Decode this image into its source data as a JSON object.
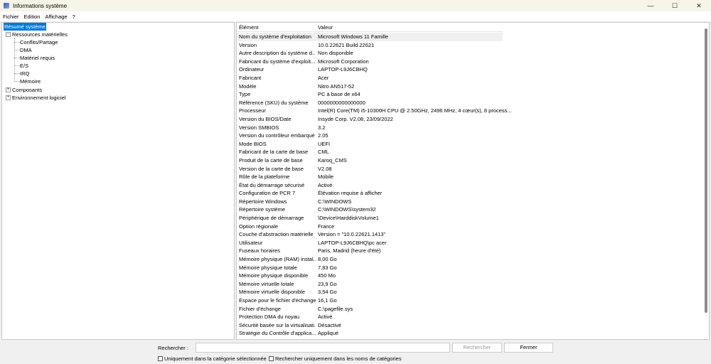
{
  "window": {
    "title": "Informations système",
    "minimize": "—",
    "maximize": "☐",
    "close": "✕"
  },
  "menu": [
    "Fichier",
    "Edition",
    "Affichage",
    "?"
  ],
  "tree": {
    "root": "Résumé système",
    "hardware": "Ressources matérielles",
    "hardware_children": [
      "Conflits/Partage",
      "DMA",
      "Matériel requis",
      "E/S",
      "IRQ",
      "Mémoire"
    ],
    "components": "Composants",
    "software": "Environnement logiciel"
  },
  "table": {
    "headers": [
      "Élément",
      "Valeur"
    ],
    "rows": [
      [
        "Nom du système d'exploitation",
        "Microsoft Windows 11 Famille"
      ],
      [
        "Version",
        "10.0.22621 Build 22621"
      ],
      [
        "Autre description du système d...",
        "Non disponible"
      ],
      [
        "Fabricant du système d'exploit...",
        "Microsoft Corporation"
      ],
      [
        "Ordinateur",
        "LAPTOP-L9J6CBHQ"
      ],
      [
        "Fabricant",
        "Acer"
      ],
      [
        "Modèle",
        "Nitro AN517-52"
      ],
      [
        "Type",
        "PC à base de x64"
      ],
      [
        "Référence (SKU) du système",
        "0000000000000000"
      ],
      [
        "Processeur",
        "Intel(R) Core(TM) i5-10300H CPU @ 2.50GHz, 2496 MHz, 4 cœur(s), 8 process..."
      ],
      [
        "Version du BIOS/Date",
        "Insyde Corp. V2.08, 23/09/2022"
      ],
      [
        "Version SMBIOS",
        "3.2"
      ],
      [
        "Version du contrôleur embarqué",
        "2.05"
      ],
      [
        "Mode BIOS",
        "UEFI"
      ],
      [
        "Fabricant de la carte de base",
        "CML"
      ],
      [
        "Produit de la carte de base",
        "Karoq_CMS"
      ],
      [
        "Version de la carte de base",
        "V2.08"
      ],
      [
        "Rôle de la plateforme",
        "Mobile"
      ],
      [
        "État du démarrage sécurisé",
        "Activé"
      ],
      [
        "Configuration de PCR 7",
        "Élévation requise à afficher"
      ],
      [
        "Répertoire Windows",
        "C:\\WINDOWS"
      ],
      [
        "Répertoire système",
        "C:\\WINDOWS\\system32"
      ],
      [
        "Périphérique de démarrage",
        "\\Device\\HarddiskVolume1"
      ],
      [
        "Option régionale",
        "France"
      ],
      [
        "Couche d'abstraction matérielle",
        "Version = \"10.0.22621.1413\""
      ],
      [
        "Utilisateur",
        "LAPTOP-L9J6CBHQ\\pc acer"
      ],
      [
        "Fuseaux horaires",
        "Paris, Madrid (heure d'été)"
      ],
      [
        "Mémoire physique (RAM) instal...",
        "8,00 Go"
      ],
      [
        "Mémoire physique totale",
        "7,83 Go"
      ],
      [
        "Mémoire physique disponible",
        "450 Mo"
      ],
      [
        "Mémoire virtuelle totale",
        "23,9 Go"
      ],
      [
        "Mémoire virtuelle disponible",
        "3,54 Go"
      ],
      [
        "Espace pour le fichier d'échange",
        "16,1 Go"
      ],
      [
        "Fichier d'échange",
        "C:\\pagefile.sys"
      ],
      [
        "Protection DMA du noyau",
        "Activé"
      ],
      [
        "Sécurité basée sur la virtualisati...",
        "Désactivé"
      ],
      [
        "Stratégie du Contrôle d'applica...",
        "Appliqué"
      ]
    ]
  },
  "search": {
    "label": "Rechercher :",
    "value": "",
    "search_button": "Rechercher",
    "close_button": "Fermer",
    "option1": "Uniquement dans la catégorie sélectionnée",
    "option2": "Rechercher uniquement dans les noms de catégories"
  }
}
